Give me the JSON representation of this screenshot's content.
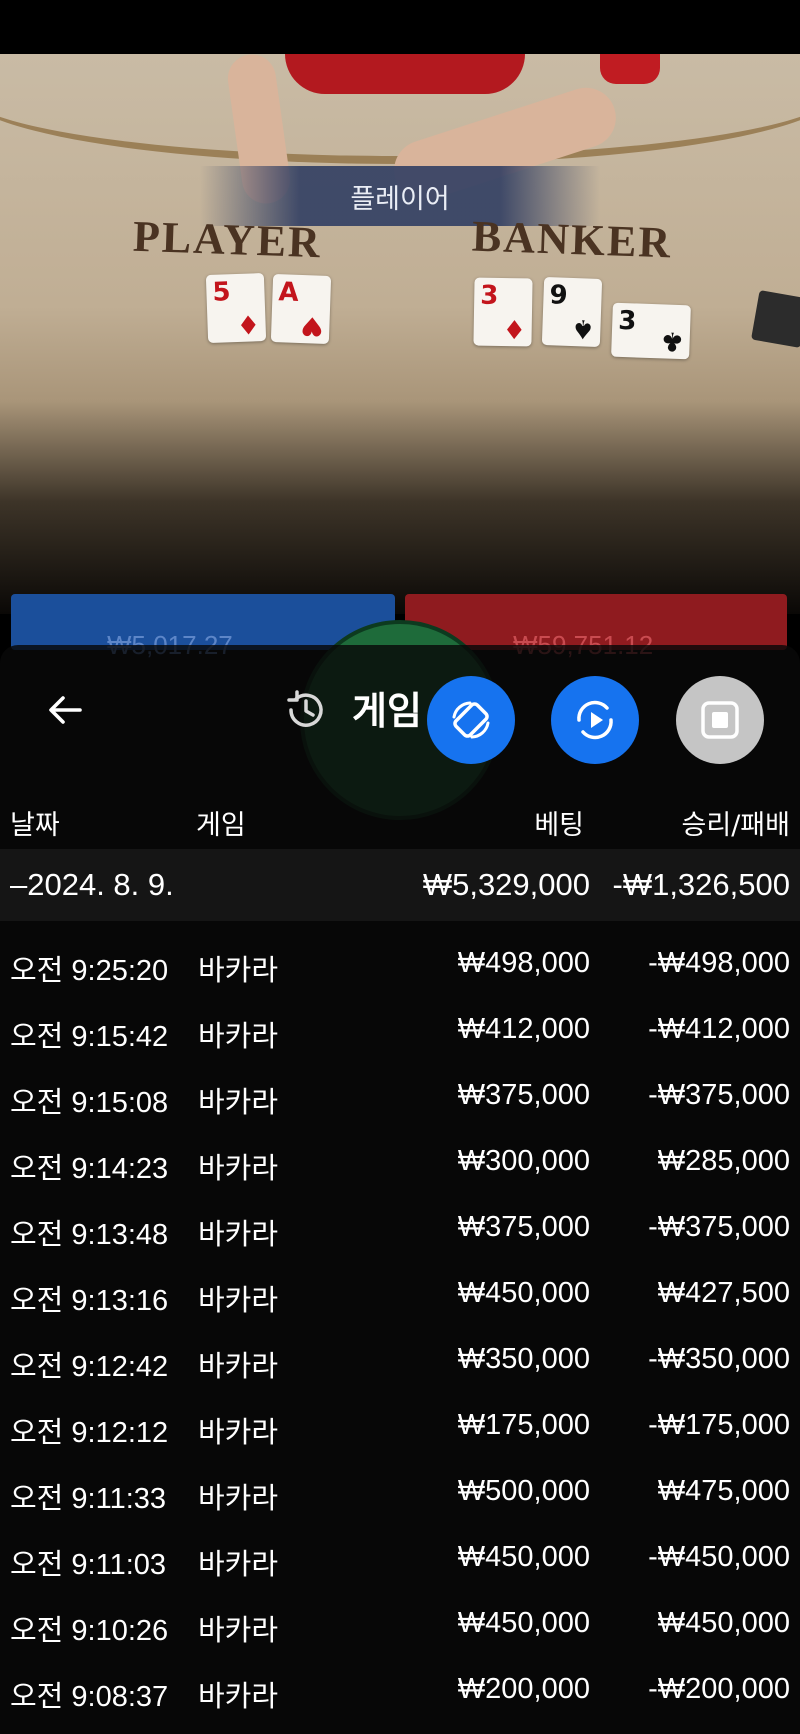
{
  "video": {
    "result_banner": "플레이어",
    "player_label": "PLAYER",
    "banker_label": "BANKER",
    "player_cards": [
      {
        "rank": "5",
        "suit": "♦",
        "color": "red"
      },
      {
        "rank": "A",
        "suit": "♥",
        "color": "red"
      }
    ],
    "banker_cards": [
      {
        "rank": "3",
        "suit": "♦",
        "color": "red"
      },
      {
        "rank": "9",
        "suit": "♠",
        "color": "black"
      },
      {
        "rank": "3",
        "suit": "♣",
        "color": "black"
      }
    ]
  },
  "background_ui": {
    "player_total": "₩5,017.27",
    "banker_total": "₩59,751.12"
  },
  "history_panel": {
    "title": "게임",
    "back_icon": "arrow-left-icon",
    "history_icon": "history-icon",
    "fab_rotate_icon": "rotate-screen-icon",
    "fab_play_icon": "play-sync-icon",
    "fab_stop_icon": "stop-icon",
    "columns": {
      "date": "날짜",
      "game": "게임",
      "bet": "베팅",
      "result": "승리/패배"
    },
    "date_summary": {
      "date": "–2024. 8. 9.",
      "bet": "₩5,329,000",
      "result": "-₩1,326,500"
    },
    "rows": [
      {
        "time": "오전 9:25:20",
        "game": "바카라",
        "bet": "₩498,000",
        "result": "-₩498,000"
      },
      {
        "time": "오전 9:15:42",
        "game": "바카라",
        "bet": "₩412,000",
        "result": "-₩412,000"
      },
      {
        "time": "오전 9:15:08",
        "game": "바카라",
        "bet": "₩375,000",
        "result": "-₩375,000"
      },
      {
        "time": "오전 9:14:23",
        "game": "바카라",
        "bet": "₩300,000",
        "result": "₩285,000"
      },
      {
        "time": "오전 9:13:48",
        "game": "바카라",
        "bet": "₩375,000",
        "result": "-₩375,000"
      },
      {
        "time": "오전 9:13:16",
        "game": "바카라",
        "bet": "₩450,000",
        "result": "₩427,500"
      },
      {
        "time": "오전 9:12:42",
        "game": "바카라",
        "bet": "₩350,000",
        "result": "-₩350,000"
      },
      {
        "time": "오전 9:12:12",
        "game": "바카라",
        "bet": "₩175,000",
        "result": "-₩175,000"
      },
      {
        "time": "오전 9:11:33",
        "game": "바카라",
        "bet": "₩500,000",
        "result": "₩475,000"
      },
      {
        "time": "오전 9:11:03",
        "game": "바카라",
        "bet": "₩450,000",
        "result": "-₩450,000"
      },
      {
        "time": "오전 9:10:26",
        "game": "바카라",
        "bet": "₩450,000",
        "result": "₩450,000"
      },
      {
        "time": "오전 9:08:37",
        "game": "바카라",
        "bet": "₩200,000",
        "result": "-₩200,000"
      }
    ]
  }
}
